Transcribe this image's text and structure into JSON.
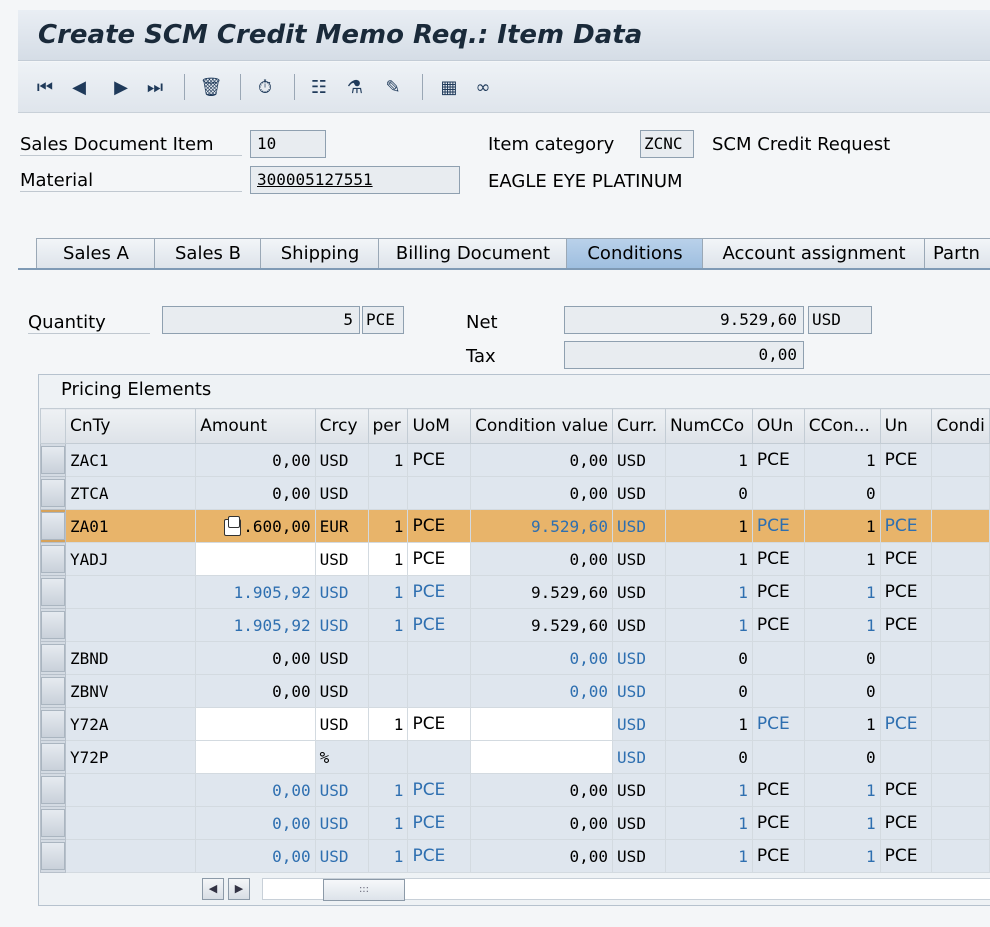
{
  "title": "Create SCM Credit Memo Req.: Item Data",
  "header": {
    "sales_doc_item_label": "Sales Document Item",
    "sales_doc_item_value": "10",
    "material_label": "Material",
    "material_value": "300005127551",
    "item_category_label": "Item category",
    "item_category_value": "ZCNC",
    "item_category_desc": "SCM Credit Request",
    "material_desc": "EAGLE EYE PLATINUM"
  },
  "tabs": [
    "Sales A",
    "Sales B",
    "Shipping",
    "Billing Document",
    "Conditions",
    "Account assignment",
    "Partn"
  ],
  "active_tab": "Conditions",
  "conditions": {
    "quantity_label": "Quantity",
    "quantity_value": "5",
    "quantity_unit": "PCE",
    "net_label": "Net",
    "net_value": "9.529,60",
    "net_currency": "USD",
    "tax_label": "Tax",
    "tax_value": "0,00"
  },
  "pricing": {
    "title": "Pricing Elements",
    "columns": [
      "CnTy",
      "Amount",
      "Crcy",
      "per",
      "UoM",
      "Condition value",
      "Curr.",
      "NumCCo",
      "OUn",
      "CCon...",
      "Un",
      "Condi"
    ],
    "rows": [
      {
        "cnty": "ZAC1",
        "amount": "0,00",
        "crcy": "USD",
        "per": "1",
        "uom": "PCE",
        "cvalue": "0,00",
        "curr": "USD",
        "numcco": "1",
        "oun": "PCE",
        "ccon": "1",
        "un": "PCE"
      },
      {
        "cnty": "ZTCA",
        "amount": "0,00",
        "crcy": "USD",
        "per": "",
        "uom": "",
        "cvalue": "0,00",
        "curr": "USD",
        "numcco": "0",
        "oun": "",
        "ccon": "0",
        "un": ""
      },
      {
        "cnty": "ZA01",
        "amount": ".600,00",
        "crcy": "EUR",
        "per": "1",
        "uom": "PCE",
        "cvalue": "9.529,60",
        "curr": "USD",
        "numcco": "1",
        "oun": "PCE",
        "ccon": "1",
        "un": "PCE"
      },
      {
        "cnty": "YADJ",
        "amount": "",
        "crcy": "USD",
        "per": "1",
        "uom": "PCE",
        "cvalue": "0,00",
        "curr": "USD",
        "numcco": "1",
        "oun": "PCE",
        "ccon": "1",
        "un": "PCE"
      },
      {
        "cnty": "",
        "amount": "1.905,92",
        "crcy": "USD",
        "per": "1",
        "uom": "PCE",
        "cvalue": "9.529,60",
        "curr": "USD",
        "numcco": "1",
        "oun": "PCE",
        "ccon": "1",
        "un": "PCE"
      },
      {
        "cnty": "",
        "amount": "1.905,92",
        "crcy": "USD",
        "per": "1",
        "uom": "PCE",
        "cvalue": "9.529,60",
        "curr": "USD",
        "numcco": "1",
        "oun": "PCE",
        "ccon": "1",
        "un": "PCE"
      },
      {
        "cnty": "ZBND",
        "amount": "0,00",
        "crcy": "USD",
        "per": "",
        "uom": "",
        "cvalue": "0,00",
        "curr": "USD",
        "numcco": "0",
        "oun": "",
        "ccon": "0",
        "un": ""
      },
      {
        "cnty": "ZBNV",
        "amount": "0,00",
        "crcy": "USD",
        "per": "",
        "uom": "",
        "cvalue": "0,00",
        "curr": "USD",
        "numcco": "0",
        "oun": "",
        "ccon": "0",
        "un": ""
      },
      {
        "cnty": "Y72A",
        "amount": "",
        "crcy": "USD",
        "per": "1",
        "uom": "PCE",
        "cvalue": "",
        "curr": "USD",
        "numcco": "1",
        "oun": "PCE",
        "ccon": "1",
        "un": "PCE"
      },
      {
        "cnty": "Y72P",
        "amount": "",
        "crcy": "%",
        "per": "",
        "uom": "",
        "cvalue": "",
        "curr": "USD",
        "numcco": "0",
        "oun": "",
        "ccon": "0",
        "un": ""
      },
      {
        "cnty": "",
        "amount": "0,00",
        "crcy": "USD",
        "per": "1",
        "uom": "PCE",
        "cvalue": "0,00",
        "curr": "USD",
        "numcco": "1",
        "oun": "PCE",
        "ccon": "1",
        "un": "PCE"
      },
      {
        "cnty": "",
        "amount": "0,00",
        "crcy": "USD",
        "per": "1",
        "uom": "PCE",
        "cvalue": "0,00",
        "curr": "USD",
        "numcco": "1",
        "oun": "PCE",
        "ccon": "1",
        "un": "PCE"
      },
      {
        "cnty": "",
        "amount": "0,00",
        "crcy": "USD",
        "per": "1",
        "uom": "PCE",
        "cvalue": "0,00",
        "curr": "USD",
        "numcco": "1",
        "oun": "PCE",
        "ccon": "1",
        "un": "PCE"
      }
    ]
  },
  "toolbar_icons": [
    "first-page-icon",
    "prev-page-icon",
    "next-page-icon",
    "last-page-icon",
    "delete-icon",
    "display-icon",
    "item-overview-icon",
    "header-details-icon",
    "edit-icon",
    "calculator-icon",
    "glasses-icon"
  ],
  "colors": {
    "highlight": "#e8b46a",
    "link_blue": "#2e6fb0",
    "title_bg": "#d5dde6",
    "active_tab": "#9ebedf"
  }
}
